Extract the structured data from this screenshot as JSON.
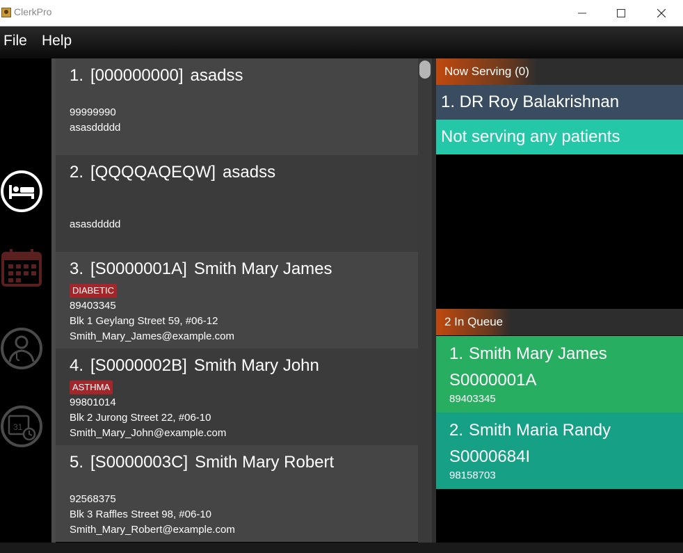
{
  "window": {
    "title": "ClerkPro"
  },
  "menu": {
    "file": "File",
    "help": "Help"
  },
  "sidebar": {
    "items": [
      {
        "icon": "patient-bed-icon",
        "active": true
      },
      {
        "icon": "calendar-icon",
        "active": false
      },
      {
        "icon": "doctor-icon",
        "active": false
      },
      {
        "icon": "schedule-clock-icon",
        "active": false
      }
    ]
  },
  "patients": [
    {
      "index": "1.",
      "id": "[000000000]",
      "name": "asadss",
      "tag": "",
      "phone": "99999990",
      "address": "asasddddd",
      "email": ""
    },
    {
      "index": "2.",
      "id": "[QQQQAQEQW]",
      "name": "asadss",
      "tag": "",
      "phone": "",
      "address": "asasddddd",
      "email": ""
    },
    {
      "index": "3.",
      "id": "[S0000001A]",
      "name": "Smith Mary James",
      "tag": "DIABETIC",
      "phone": "89403345",
      "address": "Blk 1 Geylang Street 59, #06-12",
      "email": "Smith_Mary_James@example.com"
    },
    {
      "index": "4.",
      "id": "[S0000002B]",
      "name": "Smith Mary John",
      "tag": "ASTHMA",
      "phone": "99801014",
      "address": "Blk 2 Jurong Street 22, #06-10",
      "email": "Smith_Mary_John@example.com"
    },
    {
      "index": "5.",
      "id": "[S0000003C]",
      "name": "Smith Mary Robert",
      "tag": "",
      "phone": "92568375",
      "address": "Blk 3 Raffles Street 98, #06-10",
      "email": "Smith_Mary_Robert@example.com"
    }
  ],
  "now_serving": {
    "label": "Now Serving (0)",
    "doctor": "1. DR Roy Balakrishnan",
    "status": "Not serving any patients"
  },
  "queue": {
    "label": "2 In Queue",
    "items": [
      {
        "index": "1.",
        "name": "Smith Mary James",
        "id": "S0000001A",
        "phone": "89403345",
        "color": "#27ae60"
      },
      {
        "index": "2.",
        "name": "Smith Maria Randy",
        "id": "S0000684I",
        "phone": "98158703",
        "color": "#16a085"
      }
    ]
  }
}
